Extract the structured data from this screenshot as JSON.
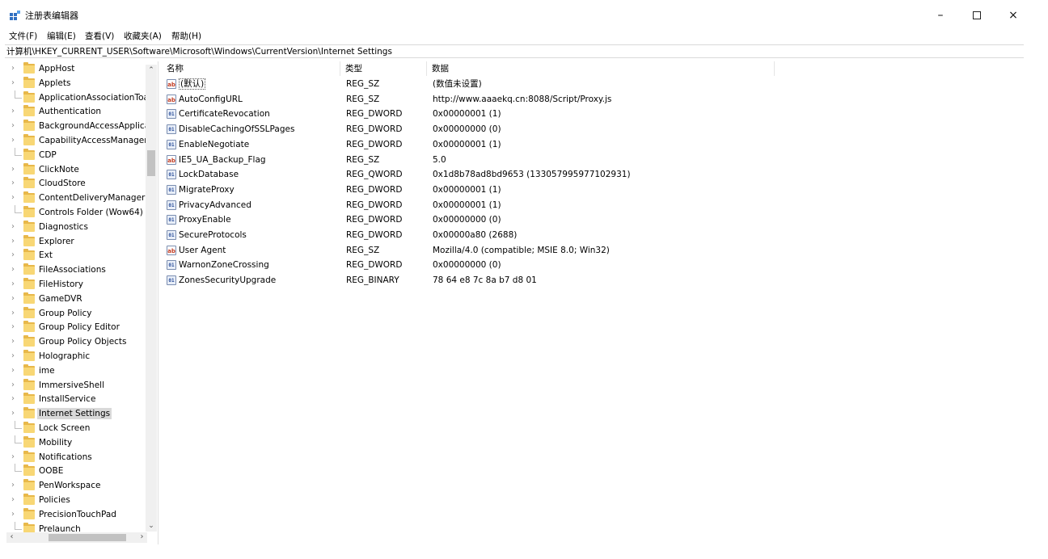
{
  "window": {
    "title": "注册表编辑器",
    "minimize": "–",
    "close": "×"
  },
  "menu": [
    "文件(F)",
    "编辑(E)",
    "查看(V)",
    "收藏夹(A)",
    "帮助(H)"
  ],
  "address": "计算机\\HKEY_CURRENT_USER\\Software\\Microsoft\\Windows\\CurrentVersion\\Internet Settings",
  "tree": {
    "selected": "Internet Settings",
    "items": [
      {
        "label": "AppHost",
        "expandable": true
      },
      {
        "label": "Applets",
        "expandable": true
      },
      {
        "label": "ApplicationAssociationToa",
        "expandable": false
      },
      {
        "label": "Authentication",
        "expandable": true
      },
      {
        "label": "BackgroundAccessApplica",
        "expandable": true
      },
      {
        "label": "CapabilityAccessManager",
        "expandable": true
      },
      {
        "label": "CDP",
        "expandable": false
      },
      {
        "label": "ClickNote",
        "expandable": true
      },
      {
        "label": "CloudStore",
        "expandable": true
      },
      {
        "label": "ContentDeliveryManager",
        "expandable": true
      },
      {
        "label": "Controls Folder (Wow64)",
        "expandable": false
      },
      {
        "label": "Diagnostics",
        "expandable": true
      },
      {
        "label": "Explorer",
        "expandable": true
      },
      {
        "label": "Ext",
        "expandable": true
      },
      {
        "label": "FileAssociations",
        "expandable": true
      },
      {
        "label": "FileHistory",
        "expandable": true
      },
      {
        "label": "GameDVR",
        "expandable": true
      },
      {
        "label": "Group Policy",
        "expandable": true
      },
      {
        "label": "Group Policy Editor",
        "expandable": true
      },
      {
        "label": "Group Policy Objects",
        "expandable": true
      },
      {
        "label": "Holographic",
        "expandable": true
      },
      {
        "label": "ime",
        "expandable": true
      },
      {
        "label": "ImmersiveShell",
        "expandable": true
      },
      {
        "label": "InstallService",
        "expandable": true
      },
      {
        "label": "Internet Settings",
        "expandable": true
      },
      {
        "label": "Lock Screen",
        "expandable": false
      },
      {
        "label": "Mobility",
        "expandable": false
      },
      {
        "label": "Notifications",
        "expandable": true
      },
      {
        "label": "OOBE",
        "expandable": false
      },
      {
        "label": "PenWorkspace",
        "expandable": true
      },
      {
        "label": "Policies",
        "expandable": true
      },
      {
        "label": "PrecisionTouchPad",
        "expandable": true
      },
      {
        "label": "Prelaunch",
        "expandable": false
      }
    ]
  },
  "columns": {
    "name": "名称",
    "type": "类型",
    "data": "数据"
  },
  "values": [
    {
      "name": "(默认)",
      "type": "REG_SZ",
      "data": "(数值未设置)",
      "icon": "string-value-icon",
      "glyph": "ab"
    },
    {
      "name": "AutoConfigURL",
      "type": "REG_SZ",
      "data": "http://www.aaaekq.cn:8088/Script/Proxy.js",
      "icon": "string-value-icon",
      "glyph": "ab"
    },
    {
      "name": "CertificateRevocation",
      "type": "REG_DWORD",
      "data": "0x00000001 (1)",
      "icon": "binary-value-icon",
      "glyph": "01"
    },
    {
      "name": "DisableCachingOfSSLPages",
      "type": "REG_DWORD",
      "data": "0x00000000 (0)",
      "icon": "binary-value-icon",
      "glyph": "01"
    },
    {
      "name": "EnableNegotiate",
      "type": "REG_DWORD",
      "data": "0x00000001 (1)",
      "icon": "binary-value-icon",
      "glyph": "01"
    },
    {
      "name": "IE5_UA_Backup_Flag",
      "type": "REG_SZ",
      "data": "5.0",
      "icon": "string-value-icon",
      "glyph": "ab"
    },
    {
      "name": "LockDatabase",
      "type": "REG_QWORD",
      "data": "0x1d8b78ad8bd9653 (133057995977102931)",
      "icon": "binary-value-icon",
      "glyph": "01"
    },
    {
      "name": "MigrateProxy",
      "type": "REG_DWORD",
      "data": "0x00000001 (1)",
      "icon": "binary-value-icon",
      "glyph": "01"
    },
    {
      "name": "PrivacyAdvanced",
      "type": "REG_DWORD",
      "data": "0x00000001 (1)",
      "icon": "binary-value-icon",
      "glyph": "01"
    },
    {
      "name": "ProxyEnable",
      "type": "REG_DWORD",
      "data": "0x00000000 (0)",
      "icon": "binary-value-icon",
      "glyph": "01"
    },
    {
      "name": "SecureProtocols",
      "type": "REG_DWORD",
      "data": "0x00000a80 (2688)",
      "icon": "binary-value-icon",
      "glyph": "01"
    },
    {
      "name": "User Agent",
      "type": "REG_SZ",
      "data": "Mozilla/4.0 (compatible; MSIE 8.0; Win32)",
      "icon": "string-value-icon",
      "glyph": "ab"
    },
    {
      "name": "WarnonZoneCrossing",
      "type": "REG_DWORD",
      "data": "0x00000000 (0)",
      "icon": "binary-value-icon",
      "glyph": "01"
    },
    {
      "name": "ZonesSecurityUpgrade",
      "type": "REG_BINARY",
      "data": "78 64 e8 7c 8a b7 d8 01",
      "icon": "binary-value-icon",
      "glyph": "01"
    }
  ]
}
